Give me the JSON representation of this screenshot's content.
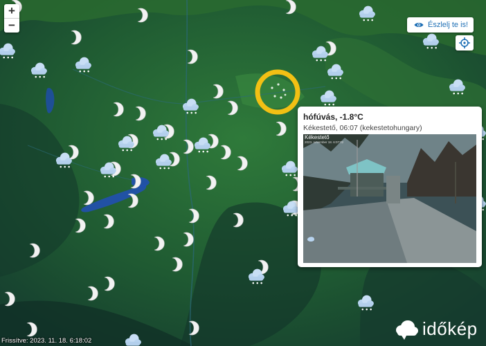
{
  "controls": {
    "zoom_in_label": "+",
    "zoom_out_label": "−",
    "observe_button_label": "Észlelj te is!",
    "observe_icon": "eye-icon",
    "locate_icon": "crosshair-icon"
  },
  "popup": {
    "title": "hófúvás, -1.8°C",
    "subtitle": "Kékestető, 06:07 (kekestetohungary)",
    "camera_label": "Kékestető",
    "camera_date": "2023. november 18. 6:07:02"
  },
  "footer": {
    "refresh_text": "Frissítve: 2023. 11. 18. 6:18:02",
    "logo_text": "időkép"
  },
  "colors": {
    "highlight_ring": "#f2c014",
    "observe_text": "#1e6fb5",
    "moon": "#f2f2f2",
    "cloud": "#b8d4f0"
  },
  "icons": {
    "weather_types": [
      "clear-night-moon-icon",
      "snow-cloud-icon",
      "cloudy-icon",
      "snow-fog-icon"
    ]
  }
}
